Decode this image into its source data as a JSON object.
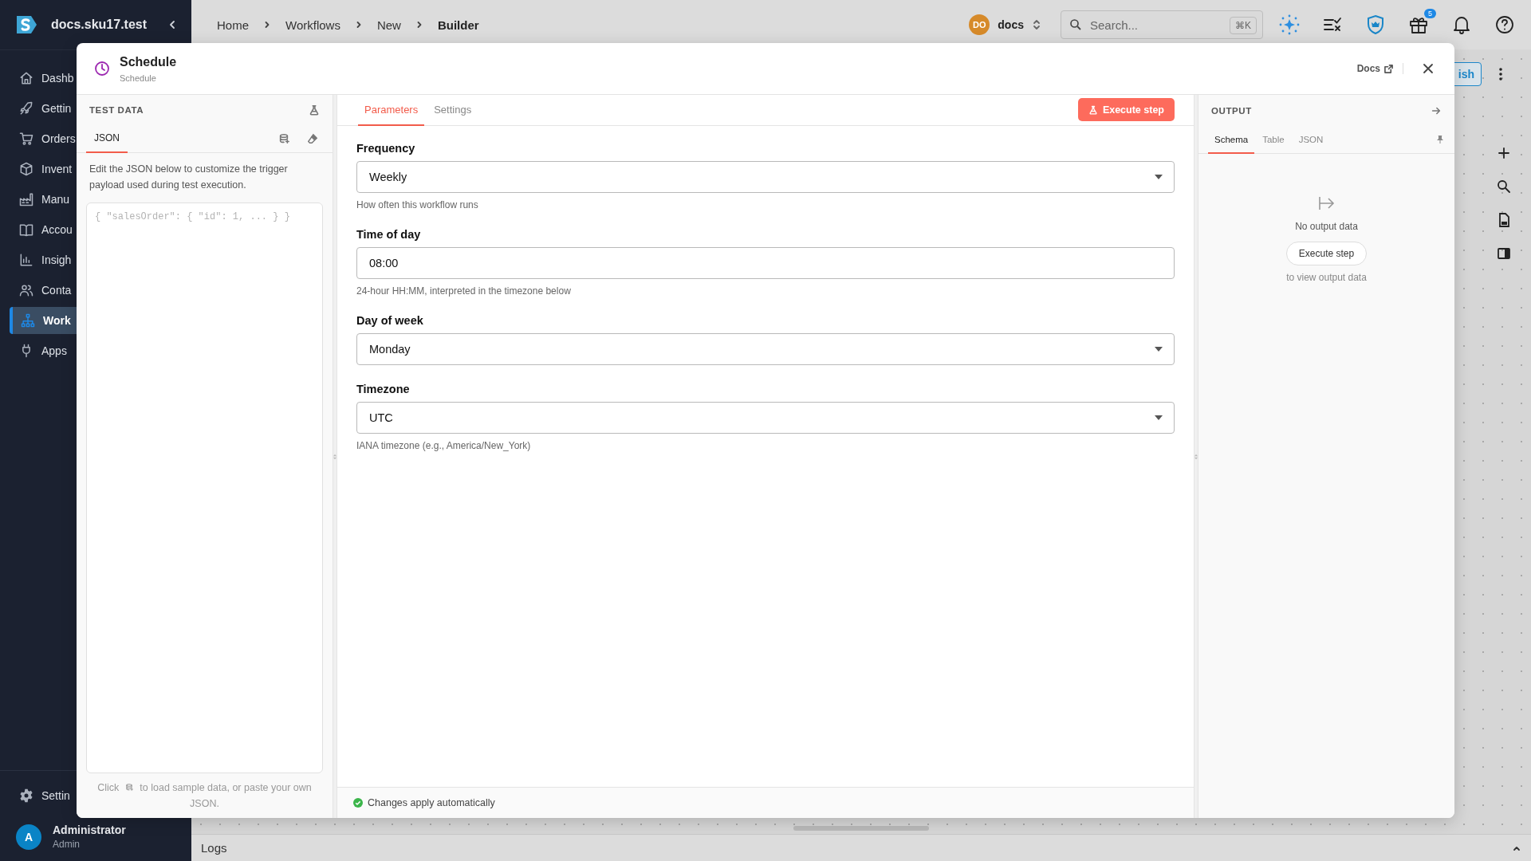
{
  "sidebar": {
    "brand": "docs.sku17.test",
    "items": [
      {
        "label": "Dashb",
        "kind": "home",
        "selected": false
      },
      {
        "label": "Gettin",
        "kind": "rocket",
        "selected": false
      },
      {
        "label": "Orders",
        "kind": "cart",
        "selected": false
      },
      {
        "label": "Invent",
        "kind": "box",
        "selected": false
      },
      {
        "label": "Manu",
        "kind": "factory",
        "selected": false
      },
      {
        "label": "Accou",
        "kind": "book",
        "selected": false
      },
      {
        "label": "Insigh",
        "kind": "chart",
        "selected": false
      },
      {
        "label": "Conta",
        "kind": "people",
        "selected": false
      },
      {
        "label": "Work",
        "kind": "tree",
        "selected": true
      },
      {
        "label": "Apps",
        "kind": "plug",
        "selected": false
      }
    ],
    "settings": "Settin",
    "user": {
      "initial": "A",
      "name": "Administrator",
      "role": "Admin"
    }
  },
  "header": {
    "breadcrumbs": [
      "Home",
      "Workflows",
      "New",
      "Builder"
    ],
    "workspace": {
      "initials": "DO",
      "name": "docs"
    },
    "search": {
      "placeholder": "Search...",
      "shortcut": "⌘K"
    },
    "gift_badge": "5"
  },
  "canvas": {
    "publish_button": "ish",
    "logs_label": "Logs"
  },
  "dialog": {
    "title": "Schedule",
    "subtitle": "Schedule",
    "docs_link": "Docs",
    "test_data": {
      "heading": "TEST DATA",
      "tabs": [
        {
          "label": "JSON",
          "selected": true
        }
      ],
      "description": "Edit the JSON below to customize the trigger payload used during test execution.",
      "editor_placeholder": "{ \"salesOrder\": { \"id\": 1, ... } }",
      "hint_before": "Click",
      "hint_after": "to load sample data, or paste your own JSON."
    },
    "tabs": [
      {
        "label": "Parameters",
        "selected": true
      },
      {
        "label": "Settings",
        "selected": false
      }
    ],
    "execute_button": "Execute step",
    "fields": [
      {
        "kind": "select",
        "label": "Frequency",
        "value": "Weekly",
        "help": "How often this workflow runs"
      },
      {
        "kind": "text",
        "label": "Time of day",
        "value": "08:00",
        "help": "24-hour HH:MM, interpreted in the timezone below"
      },
      {
        "kind": "select",
        "label": "Day of week",
        "value": "Monday"
      },
      {
        "kind": "select",
        "label": "Timezone",
        "value": "UTC",
        "help": "IANA timezone (e.g., America/New_York)"
      }
    ],
    "status": "Changes apply automatically",
    "output": {
      "heading": "OUTPUT",
      "tabs": [
        {
          "label": "Schema",
          "selected": true
        },
        {
          "label": "Table",
          "selected": false
        },
        {
          "label": "JSON",
          "selected": false
        }
      ],
      "empty_title": "No output data",
      "button": "Execute step",
      "empty_hint": "to view output data"
    }
  }
}
